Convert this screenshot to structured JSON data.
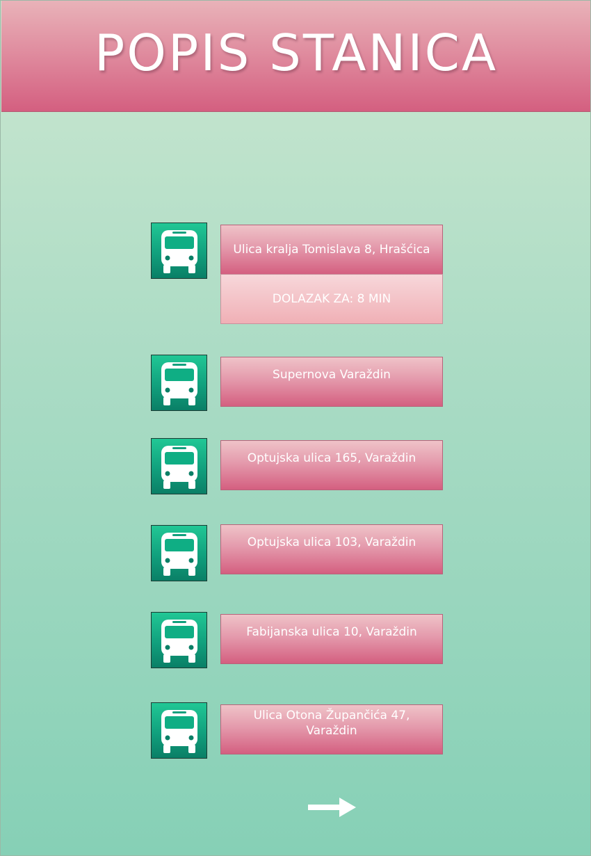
{
  "header": {
    "title": "POPIS STANICA"
  },
  "stations": [
    {
      "name": "Ulica kralja Tomislava 8, Hrašćica",
      "arrival": "DOLAZAK ZA: 8 MIN"
    },
    {
      "name": "Supernova Varaždin"
    },
    {
      "name": "Optujska ulica 165, Varaždin"
    },
    {
      "name": "Optujska ulica 103, Varaždin"
    },
    {
      "name": "Fabijanska ulica 10, Varaždin"
    },
    {
      "name": "Ulica Otona Župančića 47, Varaždin"
    }
  ],
  "icons": {
    "station": "bus-icon",
    "next": "arrow-right-icon"
  },
  "colors": {
    "header": "#d45f80",
    "icon_bg": "#11a07d",
    "background": "#a9dbc4"
  }
}
